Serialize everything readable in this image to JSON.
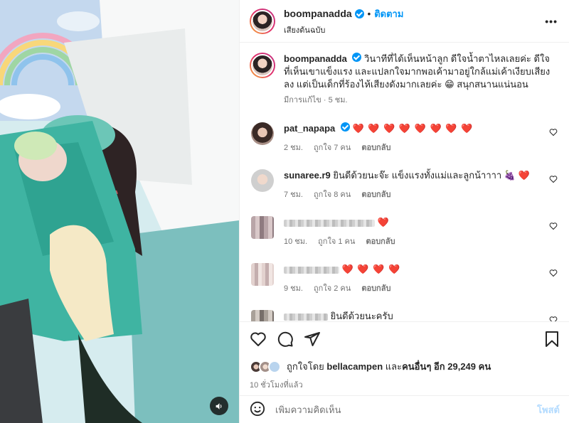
{
  "post": {
    "username": "boompanadda",
    "follow_label": "ติดตาม",
    "dot": "•",
    "subtitle": "เสียงต้นฉบับ",
    "more_label": "•••"
  },
  "caption": {
    "username": "boompanadda",
    "text": "วินาทีที่ได้เห็นหน้าลูก ดีใจน้ำตาไหลเลยค่ะ ดีใจที่เห็นเขาแข็งแรง และแปลกใจมากพอเค้ามาอยู่ใกล้แม่เค้าเงียบเสียงลง แต่เป็นเด็กที่ร้องไห้เสียงดังมากเลยค่ะ 😁 สนุกสนานแน่นอน",
    "edited": "มีการแก้ไข",
    "sep": "·",
    "time": "5 ชม."
  },
  "comments": [
    {
      "username": "pat_napapa",
      "text": "",
      "hearts": "❤️ ❤️ ❤️ ❤️ ❤️ ❤️ ❤️ ❤️",
      "time": "2 ชม.",
      "likes": "ถูกใจ 7 คน",
      "reply": "ตอบกลับ"
    },
    {
      "username": "sunaree.r9",
      "text": "ยินดีด้วยนะจ๊ะ แข็งแรงทั้งแม่และลูกน้าาาา 🍇",
      "hearts": "❤️",
      "time": "7 ชม.",
      "likes": "ถูกใจ 8 คน",
      "reply": "ตอบกลับ"
    },
    {
      "username": "",
      "text": "",
      "hearts": "❤️",
      "time": "10 ชม.",
      "likes": "ถูกใจ 1 คน",
      "reply": "ตอบกลับ"
    },
    {
      "username": "",
      "text": "",
      "hearts": "❤️ ❤️ ❤️ ❤️",
      "time": "9 ชม.",
      "likes": "ถูกใจ 2 คน",
      "reply": "ตอบกลับ"
    },
    {
      "username": "",
      "text": "ยินดีด้วยนะครับ",
      "hearts": "",
      "time": "",
      "likes": "",
      "reply": ""
    }
  ],
  "likes": {
    "prefix": "ถูกใจโดย",
    "user": "bellacampen",
    "and": "และ",
    "others": "คนอื่นๆ อีก 29,249 คน"
  },
  "posted_time": "10 ชั่วโมงที่แล้ว",
  "add_comment": {
    "placeholder": "เพิ่มความคิดเห็น",
    "post_label": "โพสต์"
  },
  "colors": {
    "accent": "#0095f6",
    "heart": "#ed1c3a",
    "muted": "#737373"
  },
  "icons": [
    "heart-icon",
    "comment-icon",
    "share-icon",
    "bookmark-icon",
    "emoji-icon",
    "speaker-icon",
    "more-icon",
    "verified-icon"
  ]
}
